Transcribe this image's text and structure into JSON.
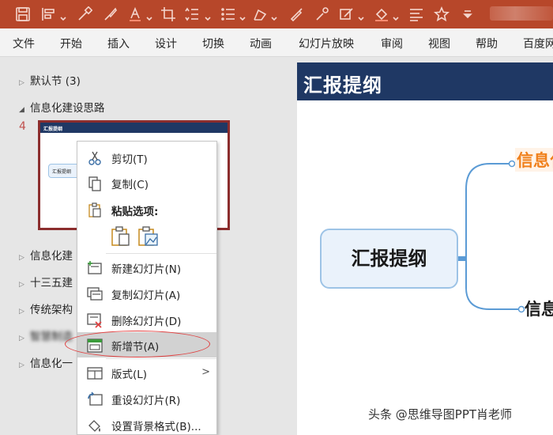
{
  "toolbar": {
    "icons": [
      "save-icon",
      "layout-icon",
      "chevron-down-icon",
      "format-painter-icon",
      "brush-icon",
      "font-color-icon",
      "crop-icon",
      "line-spacing-icon",
      "bullets-icon",
      "shape-icon",
      "pen-icon",
      "eyedropper-icon",
      "highlight-icon",
      "fill-icon",
      "align-icon",
      "star-icon",
      "customize-icon"
    ]
  },
  "ribbon": {
    "tabs": [
      "文件",
      "开始",
      "插入",
      "设计",
      "切换",
      "动画",
      "幻灯片放映",
      "审阅",
      "视图",
      "帮助",
      "百度网"
    ]
  },
  "pane": {
    "sections": [
      {
        "label": "默认节 (3)",
        "state": "collapsed"
      },
      {
        "label": "信息化建设思路",
        "state": "expanded"
      },
      {
        "label": "信息化建",
        "state": "collapsed"
      },
      {
        "label": "十三五建",
        "state": "collapsed"
      },
      {
        "label": "传统架构",
        "state": "collapsed"
      },
      {
        "label": "智慧制造",
        "state": "collapsed"
      },
      {
        "label": "信息化一",
        "state": "collapsed"
      }
    ],
    "slide_number": "4",
    "thumb_title": "汇报提纲",
    "thumb_node": "汇报提纲"
  },
  "slide": {
    "title": "汇报提纲",
    "main_node": "汇报提纲",
    "sub_node_1": "信息化",
    "sub_node_2": "信息"
  },
  "menu": {
    "cut": "剪切(T)",
    "copy": "复制(C)",
    "paste_options": "粘贴选项:",
    "new_slide": "新建幻灯片(N)",
    "duplicate_slide": "复制幻灯片(A)",
    "delete_slide": "删除幻灯片(D)",
    "add_section": "新增节(A)",
    "layout": "版式(L)",
    "reset_slide": "重设幻灯片(R)",
    "format_background": "设置背景格式(B)..."
  },
  "watermark": "头条 @思维导图PPT肖老师",
  "colors": {
    "ribbon_accent": "#b7472a",
    "slide_title_bg": "#1f3864",
    "thumb_border": "#8b2d2d",
    "highlight_ring": "#e04141",
    "orange_node": "#f0801b"
  }
}
